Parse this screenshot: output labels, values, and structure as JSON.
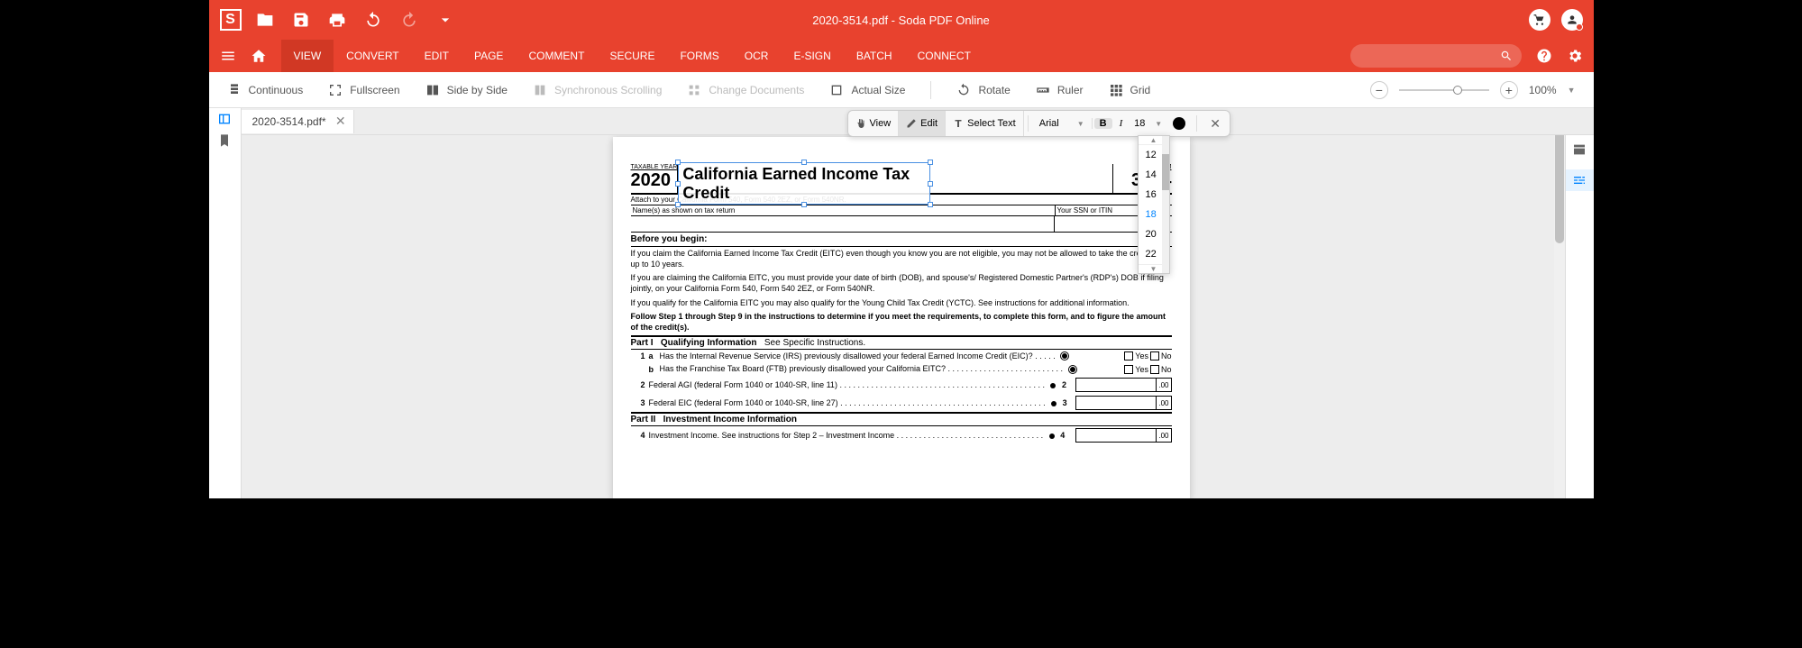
{
  "titlebar": {
    "title": "2020-3514.pdf - Soda PDF Online"
  },
  "menubar": {
    "items": [
      "VIEW",
      "CONVERT",
      "EDIT",
      "PAGE",
      "COMMENT",
      "SECURE",
      "FORMS",
      "OCR",
      "E-SIGN",
      "BATCH",
      "CONNECT"
    ],
    "active": "VIEW"
  },
  "toolbar": {
    "continuous": "Continuous",
    "fullscreen": "Fullscreen",
    "sidebyside": "Side by Side",
    "syncscroll": "Synchronous Scrolling",
    "changedocs": "Change Documents",
    "actualsize": "Actual Size",
    "rotate": "Rotate",
    "ruler": "Ruler",
    "grid": "Grid",
    "zoom_pct": "100%"
  },
  "tab": {
    "name": "2020-3514.pdf*"
  },
  "edit_toolbar": {
    "view": "View",
    "edit": "Edit",
    "select_text": "Select Text",
    "font": "Arial",
    "size": "18",
    "size_options": [
      "12",
      "14",
      "16",
      "18",
      "20",
      "22"
    ]
  },
  "document": {
    "taxable_year_label": "TAXABLE YEAR",
    "year": "2020",
    "title": "California Earned Income Tax Credit",
    "form_label": "FORM",
    "form_number": "3514",
    "attach": "Attach to your California Form 540, Form 540 2EZ, or Form 540NR.",
    "names_label": "Name(s) as shown on tax return",
    "ssn_label": "Your SSN or ITIN",
    "before_begin": "Before you begin:",
    "p1": "If you claim the California Earned Income Tax Credit (EITC) even though you know you are not eligible, you may not be allowed to take the credit for up to 10 years.",
    "p2": "If you are claiming the California EITC, you must provide your date of birth (DOB), and spouse's/ Registered Domestic Partner's (RDP's) DOB if filing jointly, on your California Form 540, Form 540 2EZ, or Form 540NR.",
    "p3": "If you qualify for the California EITC you may also qualify for the Young Child Tax Credit (YCTC). See instructions for additional information.",
    "p4": "Follow Step 1 through Step 9 in the instructions to determine if you meet the requirements, to complete this form, and to figure the amount of the credit(s).",
    "part1_label": "Part I",
    "part1_title": "Qualifying Information",
    "part1_note": "See Specific Instructions.",
    "q1a": "Has the Internal Revenue Service (IRS) previously disallowed your federal Earned Income Credit (EIC)?",
    "q1b": "Has the Franchise Tax Board (FTB) previously disallowed your California EITC?",
    "q2": "Federal AGI (federal Form 1040 or 1040-SR, line 11)",
    "q3": "Federal EIC (federal Form 1040 or 1040-SR, line 27)",
    "part2_label": "Part II",
    "part2_title": "Investment Income Information",
    "q4": "Investment Income. See instructions for Step 2 – Investment Income",
    "yes": "Yes",
    "no": "No",
    "cents": ".00"
  }
}
